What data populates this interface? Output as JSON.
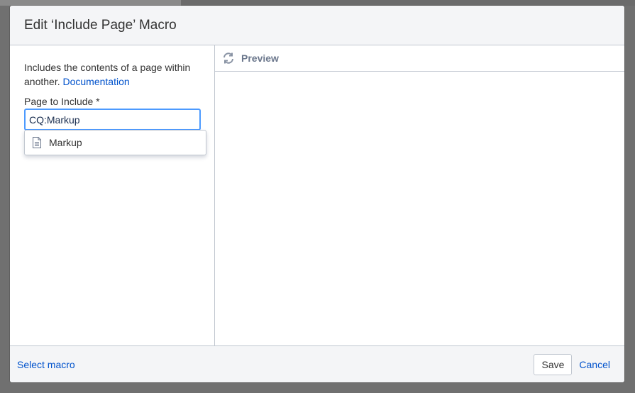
{
  "dialog": {
    "title": "Edit ‘Include Page’ Macro"
  },
  "left_pane": {
    "description": "Includes the contents of a page within another.",
    "documentation_link": "Documentation",
    "field_label": "Page to Include *",
    "input_value": "CQ:Markup",
    "suggestions": [
      {
        "label": "Markup",
        "icon": "page-icon"
      }
    ]
  },
  "preview": {
    "icon": "refresh-icon",
    "label": "Preview"
  },
  "footer": {
    "select_macro": "Select macro",
    "save_label": "Save",
    "cancel_label": "Cancel"
  },
  "colors": {
    "link": "#0052cc",
    "focus_border": "#4c9aff",
    "header_bg": "#f4f5f7",
    "overlay": "#707070"
  }
}
